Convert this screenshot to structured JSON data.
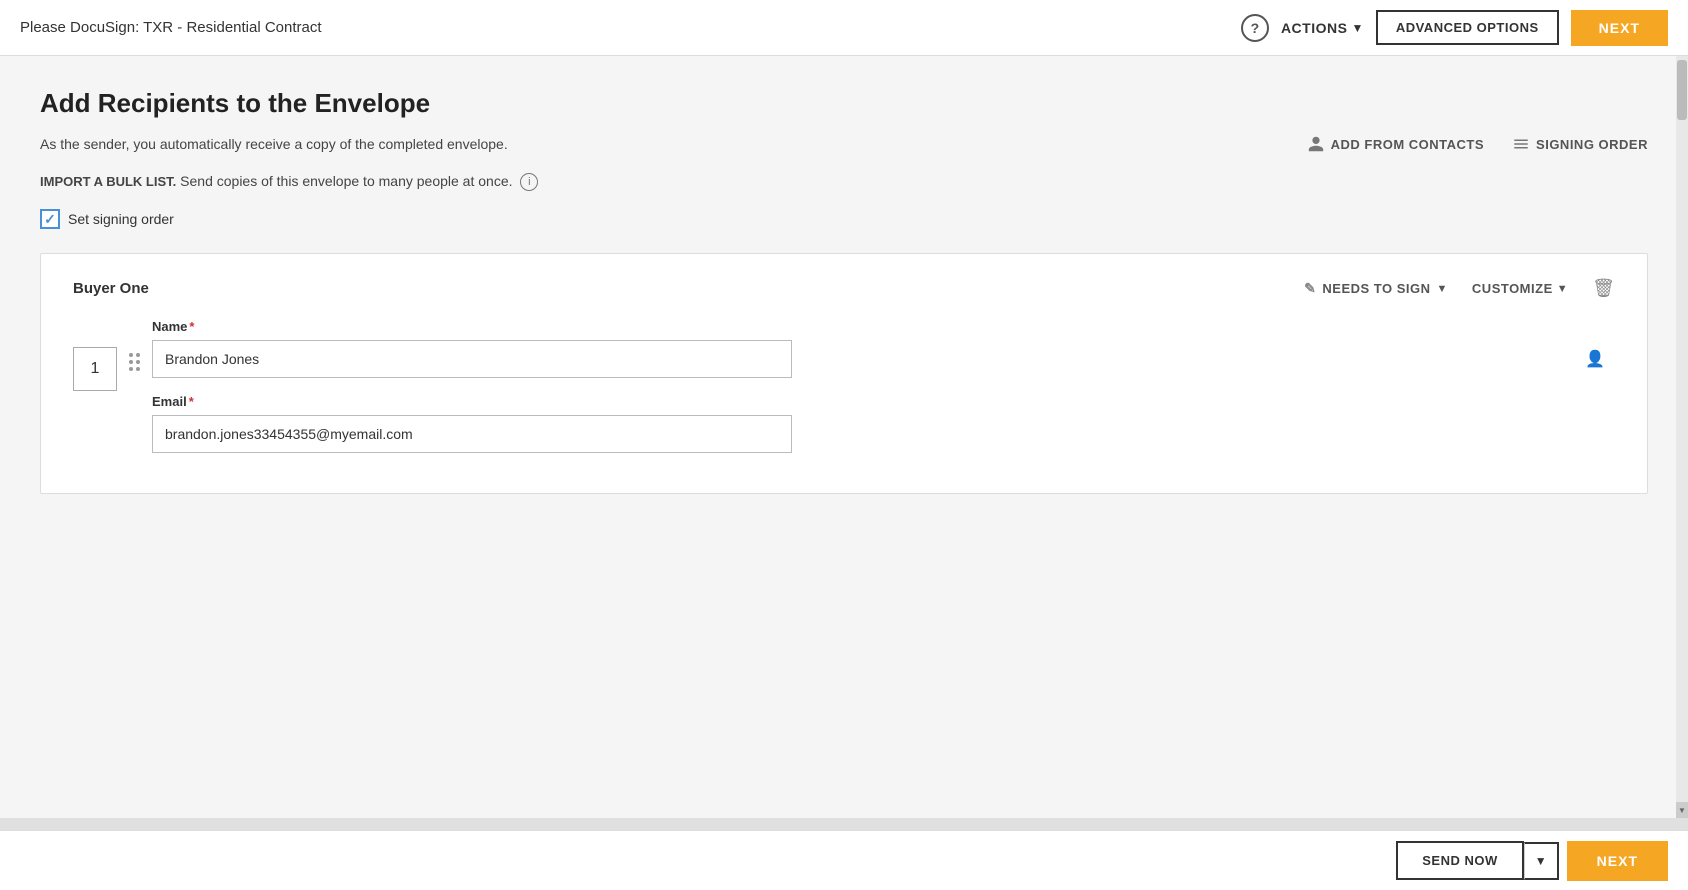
{
  "topNav": {
    "title": "Please DocuSign: TXR - Residential Contract",
    "help_label": "?",
    "actions_label": "ACTIONS",
    "advanced_options_label": "ADVANCED OPTIONS",
    "next_label": "NEXT"
  },
  "page": {
    "title": "Add Recipients to the Envelope",
    "subtitle": "As the sender, you automatically receive a copy of the completed envelope.",
    "add_from_contacts_label": "ADD FROM CONTACTS",
    "signing_order_label": "SIGNING ORDER",
    "bulk_list_label": "IMPORT A BULK LIST.",
    "bulk_list_desc": "  Send copies of this envelope to many people at once.",
    "set_signing_order_label": "Set signing order"
  },
  "recipient": {
    "title": "Buyer One",
    "needs_to_sign_label": "NEEDS TO SIGN",
    "customize_label": "CUSTOMIZE",
    "order_number": "1",
    "name_label": "Name",
    "name_required": "*",
    "name_value": "Brandon Jones",
    "email_label": "Email",
    "email_required": "*",
    "email_value": "brandon.jones33454355@myemail.com"
  },
  "bottomBar": {
    "send_now_label": "SEND NOW",
    "next_label": "NEXT"
  }
}
